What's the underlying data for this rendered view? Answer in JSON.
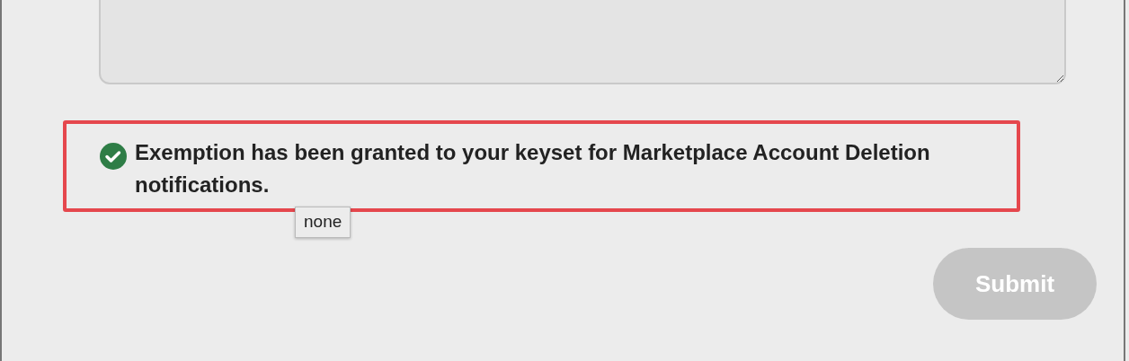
{
  "notice": {
    "text": "Exemption has been granted to your keyset for Marketplace Account Deletion notifications.",
    "highlighted": true
  },
  "tooltip": {
    "text": "none"
  },
  "submit_button": {
    "label": "Submit",
    "disabled": true
  }
}
